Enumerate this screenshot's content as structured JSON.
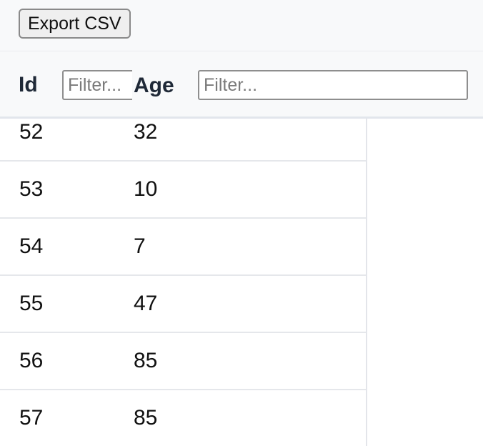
{
  "toolbar": {
    "export_label": "Export CSV"
  },
  "columns": [
    {
      "title": "Id",
      "filter_placeholder": "Filter..."
    },
    {
      "title": "Age",
      "filter_placeholder": "Filter..."
    }
  ],
  "rows": [
    {
      "id": "52",
      "age": "32"
    },
    {
      "id": "53",
      "age": "10"
    },
    {
      "id": "54",
      "age": "7"
    },
    {
      "id": "55",
      "age": "47"
    },
    {
      "id": "56",
      "age": "85"
    },
    {
      "id": "57",
      "age": "85"
    }
  ]
}
